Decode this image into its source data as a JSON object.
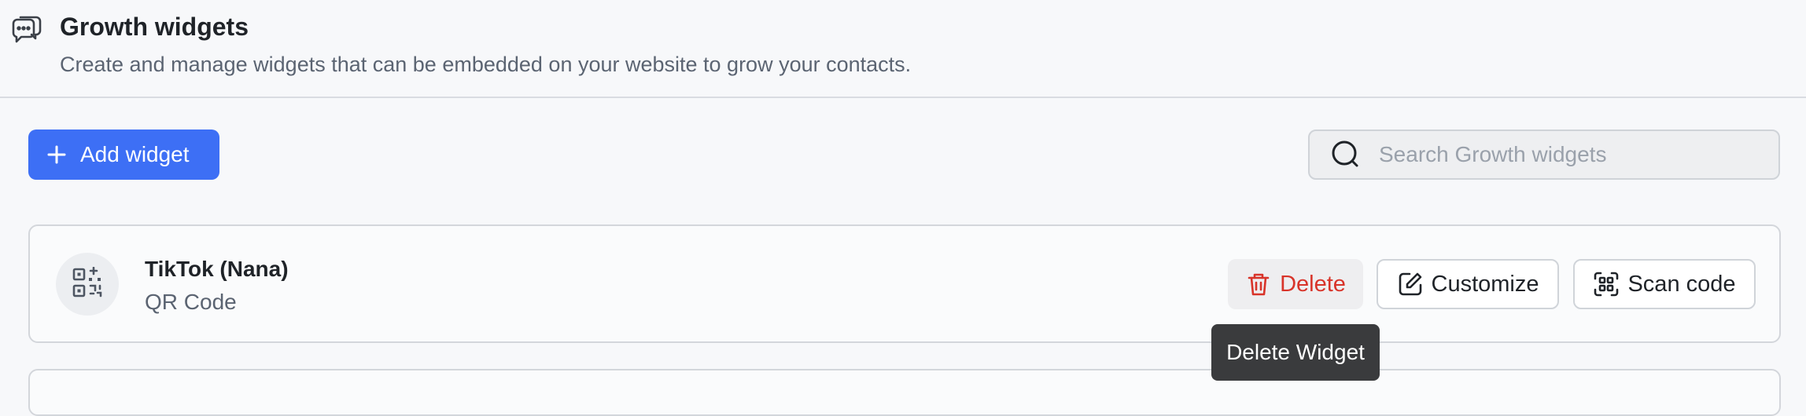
{
  "header": {
    "icon": "chat-bubbles-icon",
    "title": "Growth widgets",
    "subtitle": "Create and manage widgets that can be embedded on your website to grow your contacts."
  },
  "toolbar": {
    "add_label": "Add widget",
    "add_icon": "plus-icon",
    "search_placeholder": "Search Growth widgets",
    "search_value": "",
    "search_icon": "search-icon"
  },
  "widgets": [
    {
      "title": "TikTok (Nana)",
      "type": "QR Code",
      "icon": "qr-code-icon",
      "actions": {
        "delete_label": "Delete",
        "customize_label": "Customize",
        "scan_label": "Scan code"
      }
    }
  ],
  "tooltip": {
    "text": "Delete Widget"
  },
  "colors": {
    "accent": "#3d6ff5",
    "danger": "#d8342a",
    "tooltip_bg": "#3a3b3d"
  }
}
